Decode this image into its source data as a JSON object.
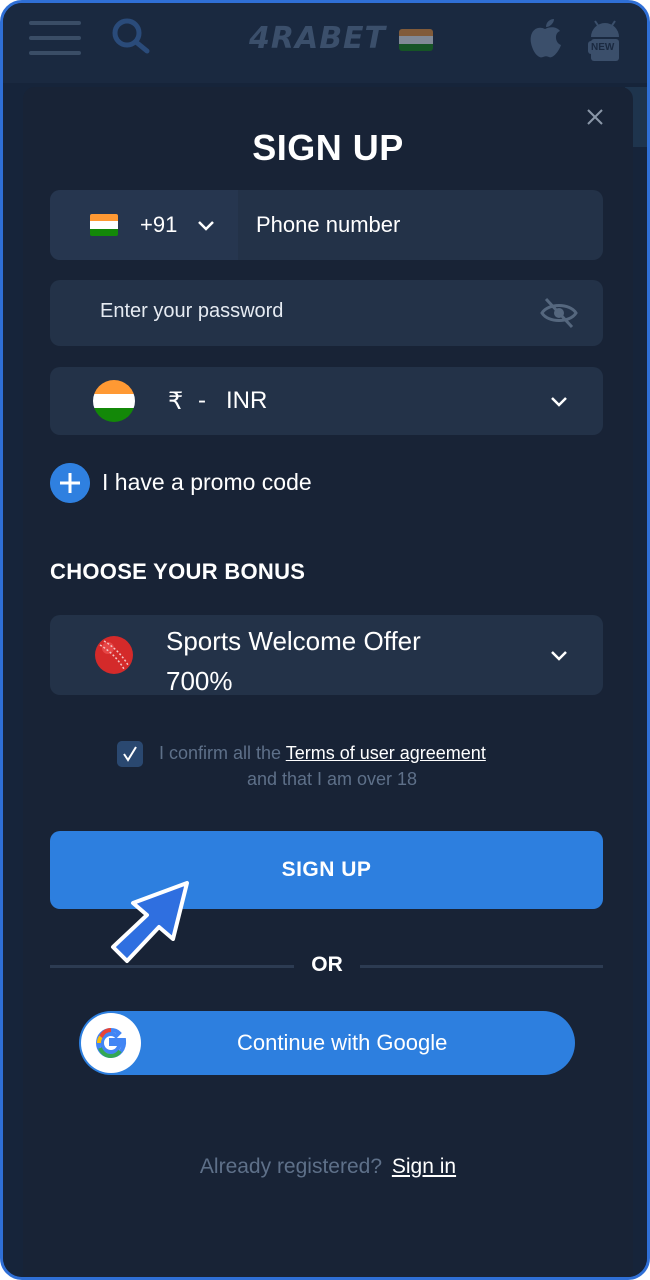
{
  "app_header": {
    "logo_text": "4RABET",
    "icons": [
      "menu-icon",
      "search-icon",
      "india-flag-icon",
      "apple-icon",
      "android-icon"
    ],
    "android_badge": "NEW"
  },
  "modal": {
    "title": "SIGN UP",
    "close_icon": "close-icon"
  },
  "phone": {
    "country_code": "+91",
    "placeholder": "Phone number",
    "flag": "india-flag-icon"
  },
  "password": {
    "placeholder": "Enter your password",
    "toggle_icon": "eye-slash-icon"
  },
  "currency": {
    "symbol": "₹",
    "separator": "-",
    "code": "INR",
    "flag": "india-flag-icon"
  },
  "promo": {
    "label": "I have a promo code"
  },
  "bonus": {
    "section_title": "CHOOSE YOUR BONUS",
    "selected_line1": "Sports Welcome Offer",
    "selected_line2": "700%",
    "icon": "cricket-ball-icon"
  },
  "confirm": {
    "checked": true,
    "prefix": "I confirm all the ",
    "link": "Terms of user agreement",
    "suffix": "and that I am over 18"
  },
  "signup_button": "SIGN UP",
  "divider_text": "OR",
  "google_button": "Continue with Google",
  "signin": {
    "prompt": "Already registered?",
    "link": "Sign in"
  },
  "colors": {
    "accent": "#2d7fdf",
    "modal_bg": "#182336",
    "field_bg": "#233248",
    "border": "#2f6fd6"
  }
}
